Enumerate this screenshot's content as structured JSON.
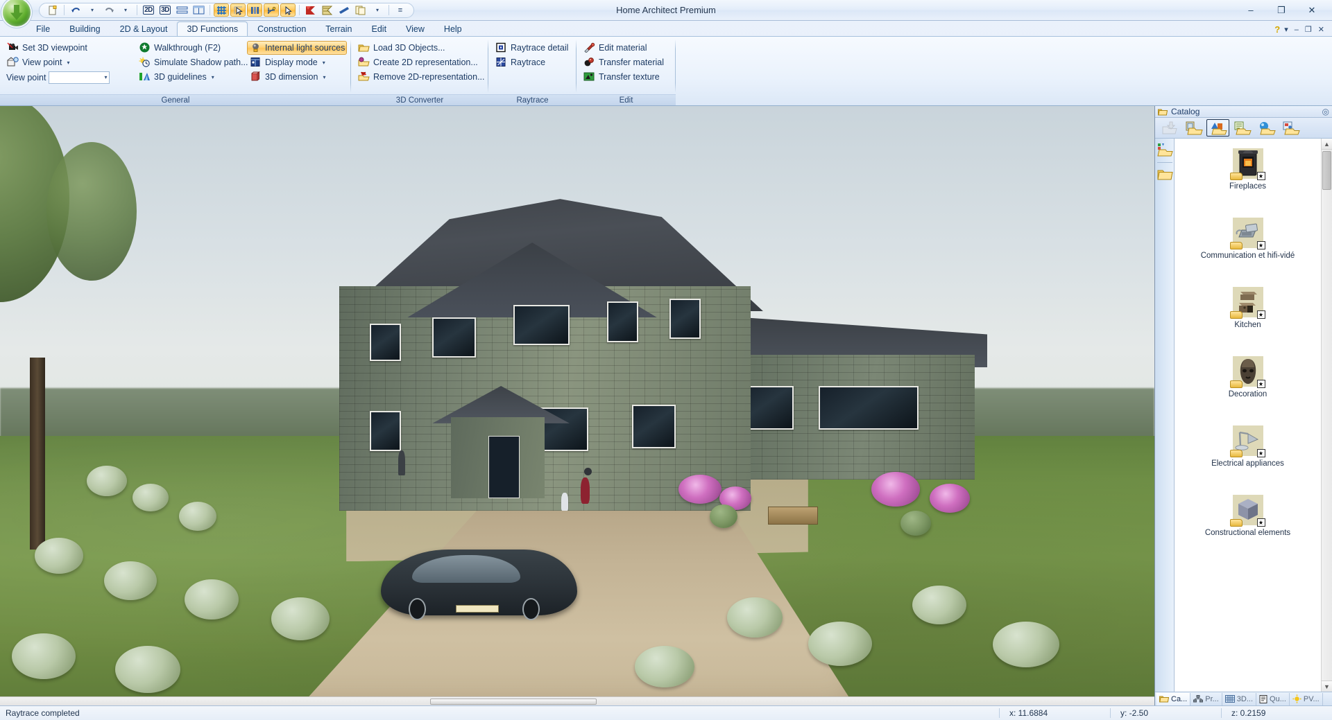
{
  "window": {
    "title": "Home Architect Premium",
    "minimize": "–",
    "maximize": "❐",
    "close": "✕"
  },
  "quick_access": {
    "items": [
      {
        "name": "new-document-icon",
        "label": ""
      },
      {
        "name": "undo-icon",
        "label": ""
      },
      {
        "name": "undo-dropdown-icon",
        "label": "▾"
      },
      {
        "name": "redo-icon",
        "label": ""
      },
      {
        "name": "redo-dropdown-icon",
        "label": "▾"
      },
      {
        "name": "view-2d-icon",
        "label": "2D"
      },
      {
        "name": "view-3d-icon",
        "label": "3D"
      },
      {
        "name": "split-horizontal-icon",
        "label": ""
      },
      {
        "name": "split-vertical-icon",
        "label": ""
      },
      {
        "name": "grid-icon",
        "label": ""
      },
      {
        "name": "select-arrow-grid-icon",
        "label": ""
      },
      {
        "name": "columns-icon",
        "label": ""
      },
      {
        "name": "snap-icon",
        "label": ""
      },
      {
        "name": "pointer-icon",
        "label": ""
      },
      {
        "name": "roof-red-icon",
        "label": ""
      },
      {
        "name": "roof-plan-icon",
        "label": ""
      },
      {
        "name": "blue-wedge-icon",
        "label": ""
      },
      {
        "name": "copy-icon",
        "label": ""
      },
      {
        "name": "more-dropdown-icon",
        "label": "▾"
      }
    ],
    "overflow": "≡"
  },
  "tabs": {
    "items": [
      {
        "label": "File",
        "active": false
      },
      {
        "label": "Building",
        "active": false
      },
      {
        "label": "2D & Layout",
        "active": false
      },
      {
        "label": "3D Functions",
        "active": true
      },
      {
        "label": "Construction",
        "active": false
      },
      {
        "label": "Terrain",
        "active": false
      },
      {
        "label": "Edit",
        "active": false
      },
      {
        "label": "View",
        "active": false
      },
      {
        "label": "Help",
        "active": false
      }
    ],
    "right_controls": [
      {
        "name": "help-icon",
        "label": "?"
      },
      {
        "name": "ribbon-options-dropdown-icon",
        "label": "▾"
      },
      {
        "name": "ribbon-minimize-icon",
        "label": "–"
      },
      {
        "name": "ribbon-restore-icon",
        "label": "❐"
      },
      {
        "name": "ribbon-close-icon",
        "label": "✕"
      }
    ]
  },
  "ribbon": {
    "groups": [
      {
        "label": "General",
        "columns": [
          {
            "items": [
              {
                "label": "Set 3D viewpoint",
                "icon": "camera-icon",
                "dropdown": false,
                "toggled": false
              },
              {
                "label": "View point",
                "icon": "viewpoint-icon",
                "dropdown": true,
                "toggled": false
              }
            ],
            "combo": {
              "label": "View point",
              "value": "",
              "placeholder": ""
            }
          },
          {
            "items": [
              {
                "label": "Walkthrough (F2)",
                "icon": "walk-icon",
                "dropdown": false,
                "toggled": false
              },
              {
                "label": "Simulate Shadow path...",
                "icon": "sun-clock-icon",
                "dropdown": false,
                "toggled": false
              },
              {
                "label": "3D guidelines",
                "icon": "guidelines-icon",
                "dropdown": true,
                "toggled": false
              }
            ]
          },
          {
            "items": [
              {
                "label": "Internal light sources",
                "icon": "lightbulb-icon",
                "dropdown": false,
                "toggled": true
              },
              {
                "label": "Display mode",
                "icon": "display-mode-icon",
                "dropdown": true,
                "toggled": false
              },
              {
                "label": "3D dimension",
                "icon": "dimension-icon",
                "dropdown": true,
                "toggled": false
              }
            ]
          }
        ]
      },
      {
        "label": "3D Converter",
        "columns": [
          {
            "items": [
              {
                "label": "Load 3D Objects...",
                "icon": "load-folder-icon",
                "dropdown": false,
                "toggled": false
              },
              {
                "label": "Create 2D representation...",
                "icon": "create-2d-icon",
                "dropdown": false,
                "toggled": false
              },
              {
                "label": "Remove 2D-representation...",
                "icon": "remove-2d-icon",
                "dropdown": false,
                "toggled": false
              }
            ]
          }
        ]
      },
      {
        "label": "Raytrace",
        "columns": [
          {
            "items": [
              {
                "label": "Raytrace detail",
                "icon": "raytrace-detail-icon",
                "dropdown": false,
                "toggled": false
              },
              {
                "label": "Raytrace",
                "icon": "raytrace-icon",
                "dropdown": false,
                "toggled": false
              }
            ]
          }
        ]
      },
      {
        "label": "Edit",
        "columns": [
          {
            "items": [
              {
                "label": "Edit material",
                "icon": "eyedropper-icon",
                "dropdown": false,
                "toggled": false
              },
              {
                "label": "Transfer material",
                "icon": "transfer-material-icon",
                "dropdown": false,
                "toggled": false
              },
              {
                "label": "Transfer texture",
                "icon": "transfer-texture-icon",
                "dropdown": false,
                "toggled": false
              }
            ]
          }
        ]
      }
    ]
  },
  "catalog": {
    "title": "Catalog",
    "pin_icon": "pin-icon",
    "toolbar": [
      {
        "name": "catalog-up-button",
        "icon": "up-folder-icon",
        "selected": false,
        "dim": true
      },
      {
        "name": "catalog-doors-windows-button",
        "icon": "door-folder-icon",
        "selected": false,
        "dim": false
      },
      {
        "name": "catalog-objects-button",
        "icon": "objects-folder-icon",
        "selected": true,
        "dim": false
      },
      {
        "name": "catalog-textures-button",
        "icon": "texture-folder-icon",
        "selected": false,
        "dim": false
      },
      {
        "name": "catalog-materials-button",
        "icon": "material-folder-icon",
        "selected": false,
        "dim": false
      },
      {
        "name": "catalog-images-button",
        "icon": "image-folder-icon",
        "selected": false,
        "dim": false
      }
    ],
    "side_buttons": [
      {
        "name": "catalog-group-button",
        "icon": "group-folder-icon"
      },
      {
        "name": "catalog-favorites-button",
        "icon": "plain-folder-icon"
      }
    ],
    "items": [
      {
        "label": "Fireplaces",
        "thumb": "fireplace-thumb"
      },
      {
        "label": "Communication et hifi-vidé",
        "thumb": "telephone-thumb"
      },
      {
        "label": "Kitchen",
        "thumb": "kitchen-thumb"
      },
      {
        "label": "Decoration",
        "thumb": "mask-thumb"
      },
      {
        "label": "Electrical appliances",
        "thumb": "lamp-thumb"
      },
      {
        "label": "Constructional elements",
        "thumb": "cube-thumb"
      }
    ],
    "scroll": {
      "up": "▲",
      "down": "▼"
    },
    "tabs": [
      {
        "label": "Ca...",
        "icon": "catalog-tab-icon",
        "active": true
      },
      {
        "label": "Pr...",
        "icon": "project-tab-icon",
        "active": false
      },
      {
        "label": "3D...",
        "icon": "3d-tab-icon",
        "active": false
      },
      {
        "label": "Qu...",
        "icon": "quantity-tab-icon",
        "active": false
      },
      {
        "label": "PV...",
        "icon": "pv-tab-icon",
        "active": false
      }
    ]
  },
  "status": {
    "message": "Raytrace completed",
    "x": "x: 11.6884",
    "y": "y: -2.50",
    "z": "z: 0.2159"
  },
  "colors": {
    "accent": "#ffc559",
    "tab_active_bg": "#f4f8fd",
    "ribbon_text": "#1c3a63",
    "group_label_bg": "#c9d9ee"
  }
}
